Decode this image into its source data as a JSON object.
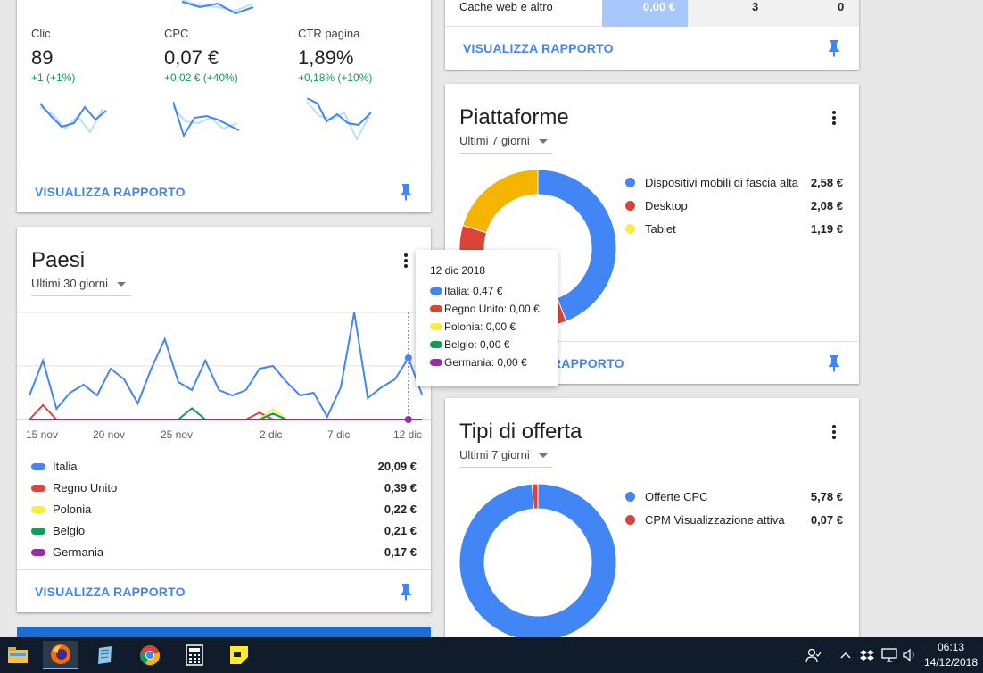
{
  "colors": {
    "blue": "#4285f4",
    "red": "#db4437",
    "yellow": "#f4b400",
    "light_yellow": "#ffeb3b",
    "green": "#0f9d58",
    "purple": "#9c27b0",
    "link": "#4285f4"
  },
  "top_card": {
    "metrics": [
      {
        "label": "Clic",
        "value": "89",
        "delta": "+1 (+1%)"
      },
      {
        "label": "CPC",
        "value": "0,07 €",
        "delta": "+0,02 € (+40%)"
      },
      {
        "label": "CTR pagina",
        "value": "1,89%",
        "delta": "+0,18% (+10%)"
      }
    ],
    "footer_link": "VISUALIZZA RAPPORTO"
  },
  "cache_card": {
    "row_label": "Cache web e altro",
    "row_values": [
      "0,00 €",
      "3",
      "0"
    ],
    "footer_link": "VISUALIZZA RAPPORTO"
  },
  "paesi_card": {
    "title": "Paesi",
    "range": "Ultimi 30 giorni",
    "footer_link": "VISUALIZZA RAPPORTO",
    "legend": [
      {
        "name": "Italia",
        "value": "20,09 €",
        "color": "#4285f4"
      },
      {
        "name": "Regno Unito",
        "value": "0,39 €",
        "color": "#db4437"
      },
      {
        "name": "Polonia",
        "value": "0,22 €",
        "color": "#ffeb3b"
      },
      {
        "name": "Belgio",
        "value": "0,21 €",
        "color": "#0f9d58"
      },
      {
        "name": "Germania",
        "value": "0,17 €",
        "color": "#9c27b0"
      }
    ],
    "tooltip": {
      "date": "12 dic 2018",
      "rows": [
        {
          "text": "Italia: 0,47 €",
          "color": "#4285f4"
        },
        {
          "text": "Regno Unito: 0,00 €",
          "color": "#db4437"
        },
        {
          "text": "Polonia: 0,00 €",
          "color": "#ffeb3b"
        },
        {
          "text": "Belgio: 0,00 €",
          "color": "#0f9d58"
        },
        {
          "text": "Germania: 0,00 €",
          "color": "#9c27b0"
        }
      ]
    }
  },
  "piattaforme_card": {
    "title": "Piattaforme",
    "range": "Ultimi 7 giorni",
    "footer_link": "RAPPORTO",
    "legend": [
      {
        "name": "Dispositivi mobili di fascia alta",
        "value": "2,58 €",
        "color": "#4285f4"
      },
      {
        "name": "Desktop",
        "value": "2,08 €",
        "color": "#db4437"
      },
      {
        "name": "Tablet",
        "value": "1,19 €",
        "color": "#ffeb3b"
      }
    ]
  },
  "offerta_card": {
    "title": "Tipi di offerta",
    "range": "Ultimi 7 giorni",
    "legend": [
      {
        "name": "Offerte CPC",
        "value": "5,78 €",
        "color": "#4285f4"
      },
      {
        "name": "CPM Visualizzazione attiva",
        "value": "0,07 €",
        "color": "#db4437"
      }
    ]
  },
  "chart_data": [
    {
      "type": "line",
      "x": [
        "14 nov",
        "15 nov",
        "16 nov",
        "17 nov",
        "18 nov",
        "19 nov",
        "20 nov",
        "21 nov",
        "22 nov",
        "23 nov",
        "24 nov",
        "25 nov",
        "26 nov",
        "27 nov",
        "28 nov",
        "29 nov",
        "30 nov",
        "1 dic",
        "2 dic",
        "3 dic",
        "4 dic",
        "5 dic",
        "6 dic",
        "7 dic",
        "8 dic",
        "9 dic",
        "10 dic",
        "11 dic",
        "12 dic",
        "13 dic"
      ],
      "xticks": [
        "15 nov",
        "20 nov",
        "25 nov",
        "2 dic",
        "7 dic",
        "12 dic"
      ],
      "series": [
        {
          "name": "Italia",
          "color": "#4285f4",
          "values": [
            0.45,
            1.1,
            0.2,
            0.5,
            0.65,
            0.45,
            0.95,
            0.75,
            0.3,
            0.95,
            1.5,
            0.7,
            0.55,
            1.1,
            0.55,
            0.45,
            0.55,
            0.95,
            1.0,
            0.7,
            0.45,
            0.5,
            0.05,
            0.6,
            2.0,
            0.4,
            0.6,
            0.75,
            1.15,
            0.47
          ]
        },
        {
          "name": "Regno Unito",
          "color": "#db4437",
          "values": [
            0,
            0.27,
            0,
            0,
            0,
            0,
            0,
            0,
            0,
            0,
            0,
            0,
            0,
            0,
            0,
            0,
            0,
            0.13,
            0,
            0,
            0,
            0,
            0,
            0,
            0,
            0,
            0,
            0,
            0,
            0
          ]
        },
        {
          "name": "Polonia",
          "color": "#ffeb3b",
          "values": [
            0,
            0,
            0,
            0,
            0,
            0,
            0,
            0,
            0,
            0,
            0,
            0,
            0,
            0,
            0,
            0,
            0,
            0,
            0.19,
            0,
            0,
            0,
            0,
            0,
            0,
            0,
            0,
            0,
            0,
            0
          ]
        },
        {
          "name": "Belgio",
          "color": "#0f9d58",
          "values": [
            0,
            0,
            0,
            0,
            0,
            0,
            0,
            0,
            0,
            0,
            0,
            0,
            0.21,
            0,
            0,
            0,
            0,
            0,
            0.11,
            0,
            0,
            0,
            0,
            0,
            0,
            0,
            0,
            0,
            0,
            0
          ]
        },
        {
          "name": "Germania",
          "color": "#9c27b0",
          "values": [
            0,
            0,
            0,
            0,
            0,
            0,
            0,
            0,
            0,
            0,
            0,
            0,
            0,
            0,
            0,
            0,
            0,
            0,
            0,
            0,
            0,
            0,
            0,
            0,
            0,
            0,
            0,
            0,
            0,
            0
          ]
        }
      ],
      "ylim": [
        0,
        2.0
      ]
    },
    {
      "type": "pie",
      "labels": [
        "Dispositivi mobili di fascia alta",
        "Desktop",
        "Tablet"
      ],
      "values": [
        2.58,
        2.08,
        1.19
      ],
      "colors": [
        "#4285f4",
        "#db4437",
        "#f4b400"
      ]
    },
    {
      "type": "pie",
      "labels": [
        "Offerte CPC",
        "CPM Visualizzazione attiva"
      ],
      "values": [
        5.78,
        0.07
      ],
      "colors": [
        "#4285f4",
        "#db4437"
      ]
    }
  ],
  "taskbar": {
    "time": "06:13",
    "date": "14/12/2018",
    "apps": [
      "file-explorer",
      "firefox",
      "notepad",
      "chrome",
      "calculator",
      "sticky-notes"
    ]
  }
}
